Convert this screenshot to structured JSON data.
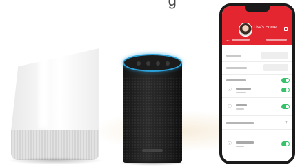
{
  "heading_partial": "g",
  "phone": {
    "user_name": "Lisa's Home",
    "accent_color": "#e3262f",
    "toggle_color": "#37c16b",
    "icons": {
      "back": "back-arrow-icon",
      "header": "door-icon",
      "device": "lamp-icon",
      "chevron": "chevron-down-icon"
    }
  },
  "devices": {
    "home_speaker": "smart-speaker-white",
    "echo_speaker": "smart-speaker-black",
    "echo_ring_color": "#2a9fd8"
  }
}
